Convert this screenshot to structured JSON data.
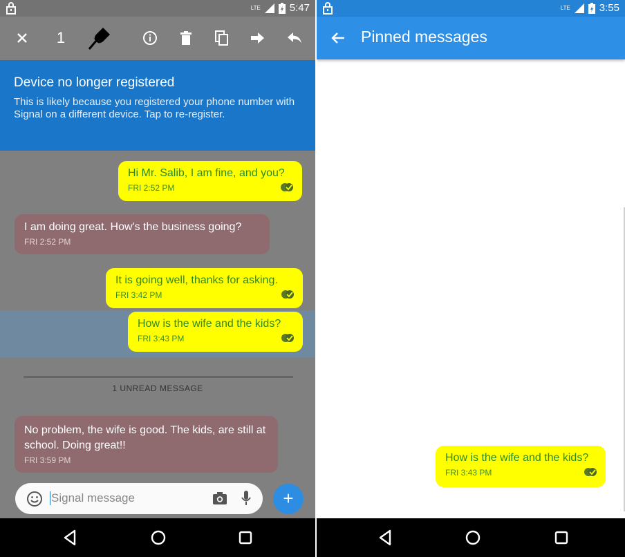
{
  "left": {
    "status": {
      "time": "5:47",
      "network": "LTE"
    },
    "actionbar": {
      "count": "1"
    },
    "banner": {
      "title": "Device no longer registered",
      "text": "This is likely because you registered your phone number with Signal on a different device. Tap to re-register."
    },
    "messages": [
      {
        "dir": "out",
        "text": "Hi Mr. Salib, I am fine, and you?",
        "time": "FRI 2:52 PM"
      },
      {
        "dir": "in",
        "text": "I am doing great. How's the business going?",
        "time": "FRI 2:52 PM"
      },
      {
        "dir": "out",
        "text": "It is going well, thanks for asking.",
        "time": "FRI 3:42 PM"
      },
      {
        "dir": "out",
        "text": "How is the wife and the kids?",
        "time": "FRI 3:43 PM",
        "selected": true
      },
      {
        "dir": "in",
        "text": "No problem, the wife is good. The kids, are still at school. Doing great!!",
        "time": "FRI 3:59 PM"
      }
    ],
    "unread_label": "1 UNREAD MESSAGE",
    "compose": {
      "placeholder": "Signal message",
      "fab": "+"
    }
  },
  "right": {
    "status": {
      "time": "3:55",
      "network": "LTE"
    },
    "title": "Pinned messages",
    "pinned": {
      "text": "How is the wife and the kids?",
      "time": "FRI 3:43 PM"
    }
  },
  "colors": {
    "out_bubble": "#ffff00",
    "out_text": "#2e8b22",
    "in_bubble": "#8f6a6f",
    "banner": "#1976c9",
    "appbar": "#2d8fe5",
    "fab": "#2d8de3"
  }
}
